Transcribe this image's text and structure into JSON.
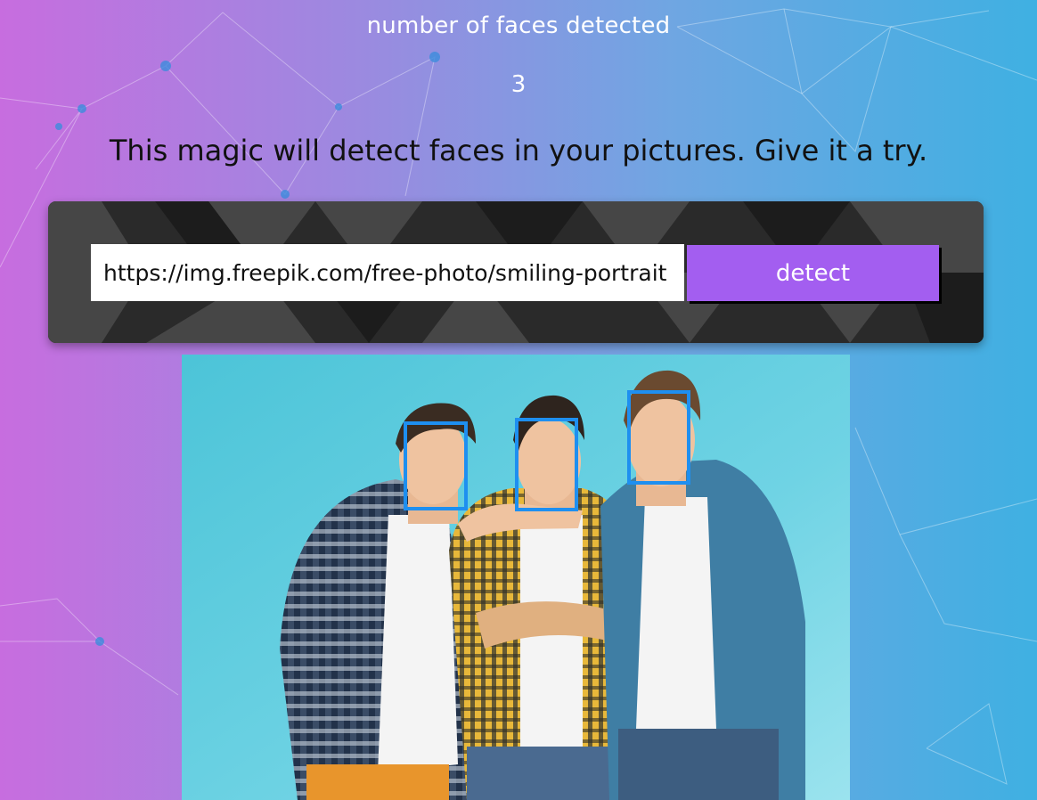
{
  "header": {
    "label": "number of faces detected",
    "count": "3"
  },
  "tagline": "This magic will detect faces in your pictures. Give it a try.",
  "form": {
    "url_value": "https://img.freepik.com/free-photo/smiling-portrait",
    "detect_label": "detect"
  },
  "photo": {
    "faces": [
      {
        "name": "face-box-left"
      },
      {
        "name": "face-box-middle"
      },
      {
        "name": "face-box-right"
      }
    ]
  },
  "colors": {
    "button": "#a35ef0",
    "face_box": "#1e8ff0",
    "photo_backdrop": "#5fcfe0"
  }
}
